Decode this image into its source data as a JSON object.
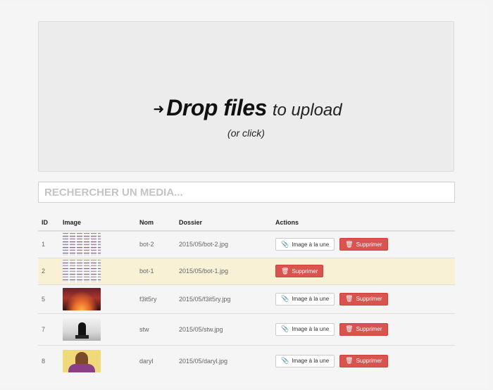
{
  "dropzone": {
    "arrow_icon": "arrow-right-icon",
    "title_strong": "Drop files",
    "title_light": "to upload",
    "subtitle": "(or click)"
  },
  "search": {
    "placeholder": "RECHERCHER UN MEDIA..."
  },
  "table": {
    "headers": [
      "ID",
      "Image",
      "Nom",
      "Dossier",
      "Actions"
    ],
    "rows": [
      {
        "id": "1",
        "nom": "bot-2",
        "dossier": "2015/05/bot-2.jpg",
        "featured": "Image à la une",
        "delete": "Supprimer",
        "highlighted": false
      },
      {
        "id": "2",
        "nom": "bot-1",
        "dossier": "2015/05/bot-1.jpg",
        "featured": "",
        "delete": "Supprimer",
        "highlighted": true
      },
      {
        "id": "5",
        "nom": "f3it5ry",
        "dossier": "2015/05/f3it5ry.jpg",
        "featured": "Image à la une",
        "delete": "Supprimer",
        "highlighted": false
      },
      {
        "id": "7",
        "nom": "stw",
        "dossier": "2015/05/stw.jpg",
        "featured": "Image à la une",
        "delete": "Supprimer",
        "highlighted": false
      },
      {
        "id": "8",
        "nom": "daryl",
        "dossier": "2015/05/daryl.jpg",
        "featured": "Image à la une",
        "delete": "Supprimer",
        "highlighted": false
      }
    ]
  },
  "icons": {
    "paperclip": "paperclip-icon",
    "trash": "trash-icon"
  },
  "colors": {
    "danger": "#d9534f",
    "highlight_row": "#f8f1d6"
  }
}
